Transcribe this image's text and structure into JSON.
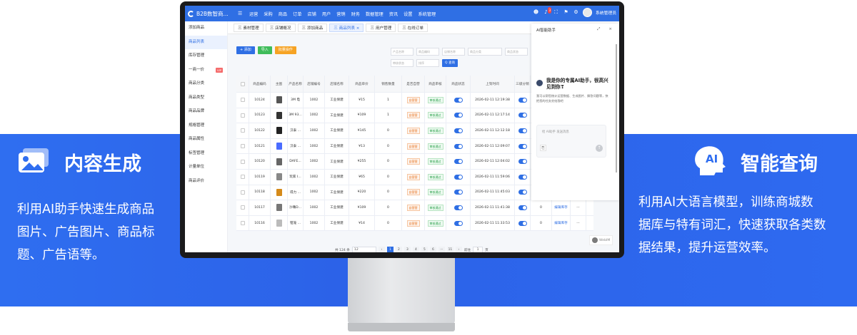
{
  "left_panel": {
    "title": "内容生成",
    "icon": "image-gallery-icon",
    "desc_lines": [
      "利用AI助手快速生成商品",
      "图片、广告图片、商品标",
      "题、广告语等。"
    ]
  },
  "right_panel": {
    "title": "智能查询",
    "icon": "ai-head-icon",
    "icon_text": "AI",
    "desc_lines": [
      "利用AI大语言模型，训练商城数",
      "据库与特有词汇，快速获取各类数",
      "据结果，提升运营效率。"
    ]
  },
  "app": {
    "logo": "B2B数智商...",
    "nav": [
      "运营",
      "采购",
      "商品",
      "订单",
      "店铺",
      "用户",
      "营销",
      "财务",
      "数据管理",
      "资讯",
      "设置",
      "系统管理"
    ],
    "notify_count": "3",
    "user_name": "系统管理员"
  },
  "sidebar": [
    {
      "label": "添加商品",
      "active": false
    },
    {
      "label": "商品列表",
      "active": true
    },
    {
      "label": "库存管理",
      "active": false
    },
    {
      "label": "一商一价",
      "active": false,
      "tag": "VIP"
    },
    {
      "label": "商品分类",
      "active": false
    },
    {
      "label": "商品类型",
      "active": false
    },
    {
      "label": "商品品牌",
      "active": false
    },
    {
      "label": "规格管理",
      "active": false
    },
    {
      "label": "商品属性",
      "active": false
    },
    {
      "label": "标签管理",
      "active": false
    },
    {
      "label": "计量单位",
      "active": false
    },
    {
      "label": "商品评价",
      "active": false
    }
  ],
  "tabs": [
    {
      "label": "三 素材管理",
      "active": false
    },
    {
      "label": "三 店铺概况",
      "active": false
    },
    {
      "label": "三 添加商品",
      "active": false
    },
    {
      "label": "三 商品列表 ×",
      "active": true
    },
    {
      "label": "三 用户管理",
      "active": false
    },
    {
      "label": "三 在线订单",
      "active": false
    }
  ],
  "actions": {
    "add": "+ 添加",
    "import": "导入",
    "batch": "批量操作"
  },
  "filters": {
    "product_name": "产品名称",
    "product_code": "商品编码",
    "brand": "店铺名称",
    "category": "商品分类",
    "status": "商品状态",
    "audit": "审核状态",
    "sort": "排序",
    "query": "Q 查询"
  },
  "table": {
    "headers": [
      "",
      "商品编码",
      "主图",
      "产品名称",
      "店铺编号",
      "店铺名称",
      "商品单价",
      "销售数量",
      "是否自营",
      "商品审核",
      "商品状态",
      "上架时间",
      "三级分销",
      "库存",
      "操作",
      ""
    ],
    "rows": [
      {
        "code": "10124",
        "name": "3M 电",
        "shop_no": "1002",
        "shop": "工业保建",
        "price": "¥15",
        "sales": "1",
        "self": "自营营",
        "audit": "审核通过",
        "time": "2026-02-11 12:19:38",
        "stock": "0"
      },
      {
        "code": "10123",
        "name": "3M 93...",
        "shop_no": "1002",
        "shop": "工业保建",
        "price": "¥109",
        "sales": "1",
        "self": "自营营",
        "audit": "审核通过",
        "time": "2026-02-11 12:17:14",
        "stock": "0"
      },
      {
        "code": "10122",
        "name": "汉泰 ...",
        "shop_no": "1002",
        "shop": "工业保建",
        "price": "¥145",
        "sales": "0",
        "self": "自营营",
        "audit": "审核通过",
        "time": "2026-02-11 12:12:18",
        "stock": "0"
      },
      {
        "code": "10121",
        "name": "汉泰 ...",
        "shop_no": "1002",
        "shop": "工业保建",
        "price": "¥13",
        "sales": "0",
        "self": "自营营",
        "audit": "审核通过",
        "time": "2026-02-11 12:09:07",
        "stock": "0"
      },
      {
        "code": "10120",
        "name": "DAFE...",
        "shop_no": "1002",
        "shop": "工业保建",
        "price": "¥255",
        "sales": "0",
        "self": "自营营",
        "audit": "审核通过",
        "time": "2026-02-11 12:04:02",
        "stock": "0"
      },
      {
        "code": "10119",
        "name": "玩家 I...",
        "shop_no": "1002",
        "shop": "工业保建",
        "price": "¥65",
        "sales": "0",
        "self": "自营营",
        "audit": "审核通过",
        "time": "2026-02-11 11:59:06",
        "stock": "0"
      },
      {
        "code": "10118",
        "name": "得力 ...",
        "shop_no": "1002",
        "shop": "工业保建",
        "price": "¥220",
        "sales": "0",
        "self": "自营营",
        "audit": "审核通过",
        "time": "2026-02-11 11:45:03",
        "stock": "0"
      },
      {
        "code": "10117",
        "name": "沙嘴D...",
        "shop_no": "1002",
        "shop": "工业保建",
        "price": "¥109",
        "sales": "0",
        "self": "自营营",
        "audit": "审核通过",
        "time": "2026-02-11 11:41:38",
        "stock": "0"
      },
      {
        "code": "10116",
        "name": "钳笼 ...",
        "shop_no": "1002",
        "shop": "工业保建",
        "price": "¥14",
        "sales": "0",
        "self": "自营营",
        "audit": "审核通过",
        "time": "2026-02-11 11:33:53",
        "stock": "0"
      }
    ],
    "op_edit": "编辑",
    "op_stock": "库存",
    "op_more": "···"
  },
  "pager": {
    "total": "共 124 条",
    "size": "12",
    "pages": [
      "1",
      "2",
      "3",
      "4",
      "5",
      "6",
      "···",
      "11"
    ],
    "current": "1",
    "goto": "前往",
    "goto_value": "1",
    "goto_unit": "页"
  },
  "assistant": {
    "title": "AI智能助手",
    "greeting": "我是你的专属AI助手，很高兴见到你❣",
    "sub": "我可以帮您统计运营数据、生成图片、解答问题等，快把您的任务交给我吧",
    "placeholder": "给 AI助手 发送消息",
    "send_icon": "send-arrow-icon",
    "clip_icon": "attachment-icon"
  },
  "webiri": "WebIM",
  "colors": {
    "band": "#2c62e8",
    "accent": "#2f6fe4",
    "tag_orange": "#e6721e",
    "tag_green": "#2aa14a"
  }
}
